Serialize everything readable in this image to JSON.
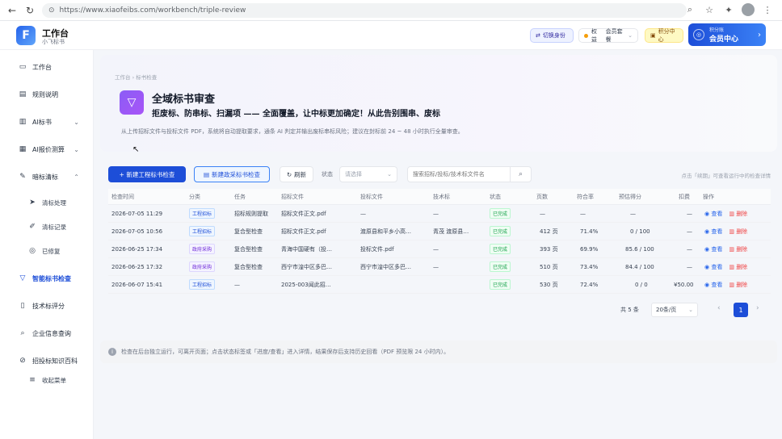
{
  "browser": {
    "url": "https://www.xiaofeibs.com/workbench/triple-review"
  },
  "header": {
    "brand_title": "工作台",
    "brand_sub": "小飞标书",
    "switch_label": "切换身份",
    "perm_label": "权益",
    "perm_value": "会员套餐",
    "points_label": "积分中心",
    "member_top": "积分账",
    "member_label": "会员中心"
  },
  "sidebar": {
    "items": [
      {
        "label": "工作台",
        "icon": "monitor-icon"
      },
      {
        "label": "规则说明",
        "icon": "document-icon"
      },
      {
        "label": "AI标书",
        "icon": "ai-document-icon"
      },
      {
        "label": "AI报价测算",
        "icon": "calculator-icon"
      },
      {
        "label": "暗标清标",
        "icon": "tool-icon"
      },
      {
        "label": "清标处理",
        "icon": "send-icon"
      },
      {
        "label": "清标记录",
        "icon": "pencil-icon"
      },
      {
        "label": "已修复",
        "icon": "check-circle-icon"
      },
      {
        "label": "智能标书检查",
        "icon": "funnel-icon"
      },
      {
        "label": "技术标评分",
        "icon": "cup-icon"
      },
      {
        "label": "企业信息查询",
        "icon": "search-icon"
      },
      {
        "label": "招投标知识百科",
        "icon": "book-icon"
      },
      {
        "label": "收起菜单",
        "icon": "menu-icon"
      }
    ]
  },
  "hero": {
    "breadcrumb": "工作台 › 标书检查",
    "title": "全域标书审查",
    "subtitle": "拒废标、防串标、扫漏项 —— 全面覆盖，让中标更加确定！从此告别围串、废标",
    "description": "从上传招标文件与投标文件 PDF，系统将自动提取要求，通条 AI 判定并输出废标串标风险；建议在封标前 24 ~ 48 小时执行全量审查。"
  },
  "toolbar": {
    "new_label": "+ 新建工程标书检查",
    "new_gov_label": "新建政采标书检查",
    "refresh_label": "刷新",
    "status_label": "状态",
    "status_placeholder": "请选择",
    "search_placeholder": "搜索招标/投标/技术标文件名",
    "hint": "点击「续期」可查看运行中的检查详情"
  },
  "table": {
    "columns": [
      "检查时间",
      "分类",
      "任务",
      "招标文件",
      "投标文件",
      "技术标",
      "状态",
      "页数",
      "符合率",
      "预估得分",
      "扣费",
      "操作"
    ],
    "rows": [
      {
        "time": "2026-07-05 11:29",
        "category": "工程招标",
        "task": "招标规则提取",
        "tender": "招标文件正文.pdf",
        "bid": "—",
        "tech": "—",
        "status": "已完成",
        "pages": "—",
        "rate": "—",
        "score": "—",
        "fee": "—",
        "view": "查看",
        "del": "删除"
      },
      {
        "time": "2026-07-05 10:56",
        "category": "工程招标",
        "task": "复合型检查",
        "tender": "招标文件正文.pdf",
        "bid": "渡原县和平乡小高…",
        "tech": "青茂 渡原县…",
        "status": "已完成",
        "pages": "412 页",
        "rate": "71.4%",
        "score": "0 / 100",
        "fee": "—",
        "view": "查看",
        "del": "删除"
      },
      {
        "time": "2026-06-25 17:34",
        "category": "政府采购",
        "task": "复合型检查",
        "tender": "青海中国硬有（投…",
        "bid": "投标文件.pdf",
        "tech": "—",
        "status": "已完成",
        "pages": "393 页",
        "rate": "69.9%",
        "score": "85.6 / 100",
        "fee": "—",
        "view": "查看",
        "del": "删除"
      },
      {
        "time": "2026-06-25 17:32",
        "category": "政府采购",
        "task": "复合型检查",
        "tender": "西宁市湟中区多巴…",
        "bid": "西宁市湟中区多巴…",
        "tech": "—",
        "status": "已完成",
        "pages": "510 页",
        "rate": "73.4%",
        "score": "84.4 / 100",
        "fee": "—",
        "view": "查看",
        "del": "删除"
      },
      {
        "time": "2026-06-07 15:41",
        "category": "工程招标",
        "task": "—",
        "tender": "2025-003闻此招…",
        "bid": "",
        "tech": "",
        "status": "已完成",
        "pages": "530 页",
        "rate": "72.4%",
        "score": "0 / 0",
        "fee": "¥50.00",
        "view": "查看",
        "del": "删除"
      }
    ]
  },
  "pager": {
    "total": "共 5 条",
    "size": "20条/页",
    "current": "1"
  },
  "footnote": "检查在后台独立运行，可离开页面；点击状态标签或「进度/查看」进入详情，结果保存后支持历史回看（PDF 预览限 24 小时内）。",
  "colors": {
    "primary": "#1d4ed8",
    "hero_icon": "#8b5cf6",
    "done": "#16a34a",
    "danger": "#ef4444"
  }
}
